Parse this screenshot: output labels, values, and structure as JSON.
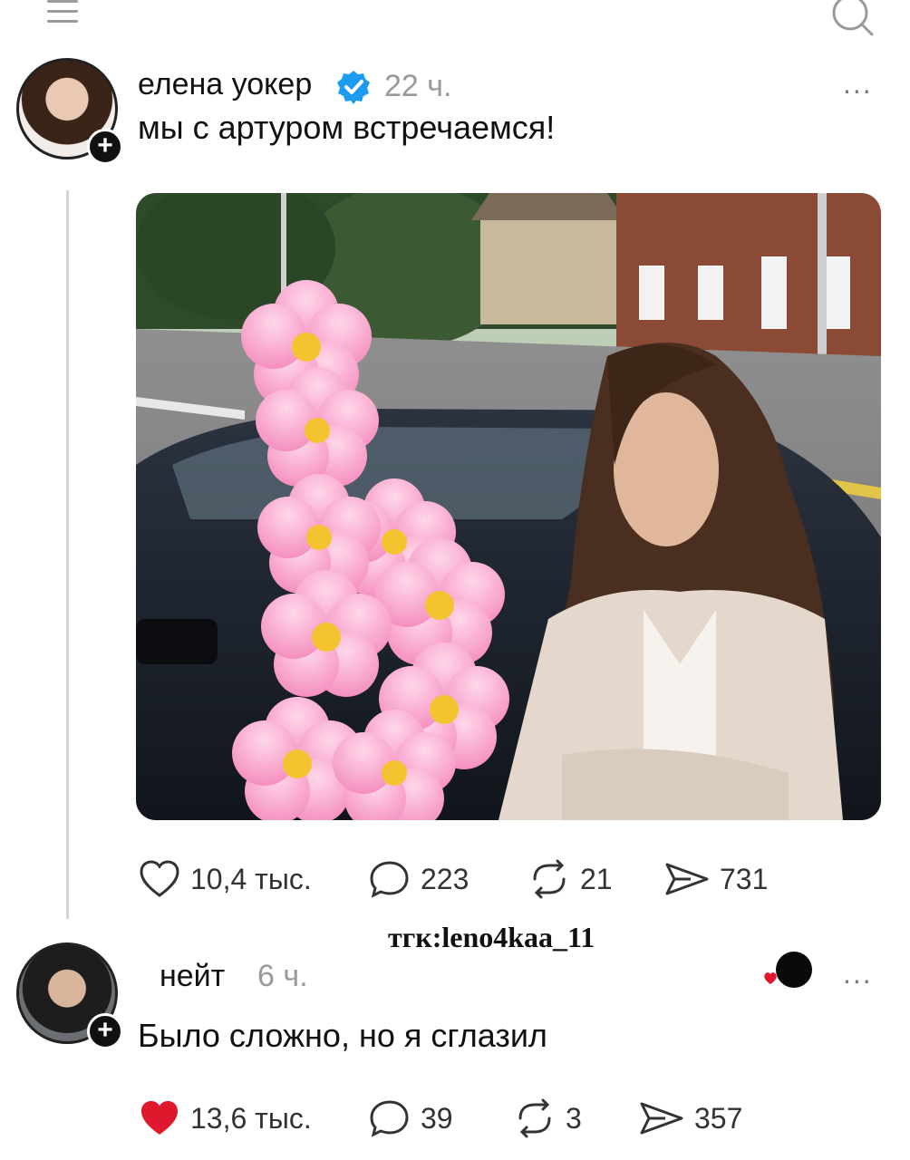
{
  "post": {
    "author": "елена уокер",
    "time": "22 ч.",
    "text": "мы с артуром встречаемся!",
    "more": "...",
    "stats": {
      "likes": "10,4 тыс.",
      "comments": "223",
      "reposts": "21",
      "shares": "731"
    }
  },
  "watermark": "тгк:leno4kaa_11",
  "reply": {
    "author": "нейт",
    "time": "6 ч.",
    "text": "Было сложно, но я сглазил",
    "more": "...",
    "stats": {
      "likes": "13,6 тыс.",
      "comments": "39",
      "reposts": "3",
      "shares": "357"
    }
  },
  "colors": {
    "verified": "#1d9bf0",
    "liked_heart": "#e0182d",
    "muted_text": "#9a9a9a"
  },
  "icons": [
    "menu-icon",
    "search-icon",
    "verified-icon",
    "heart-icon",
    "comment-icon",
    "repost-icon",
    "share-icon",
    "plus-icon"
  ]
}
